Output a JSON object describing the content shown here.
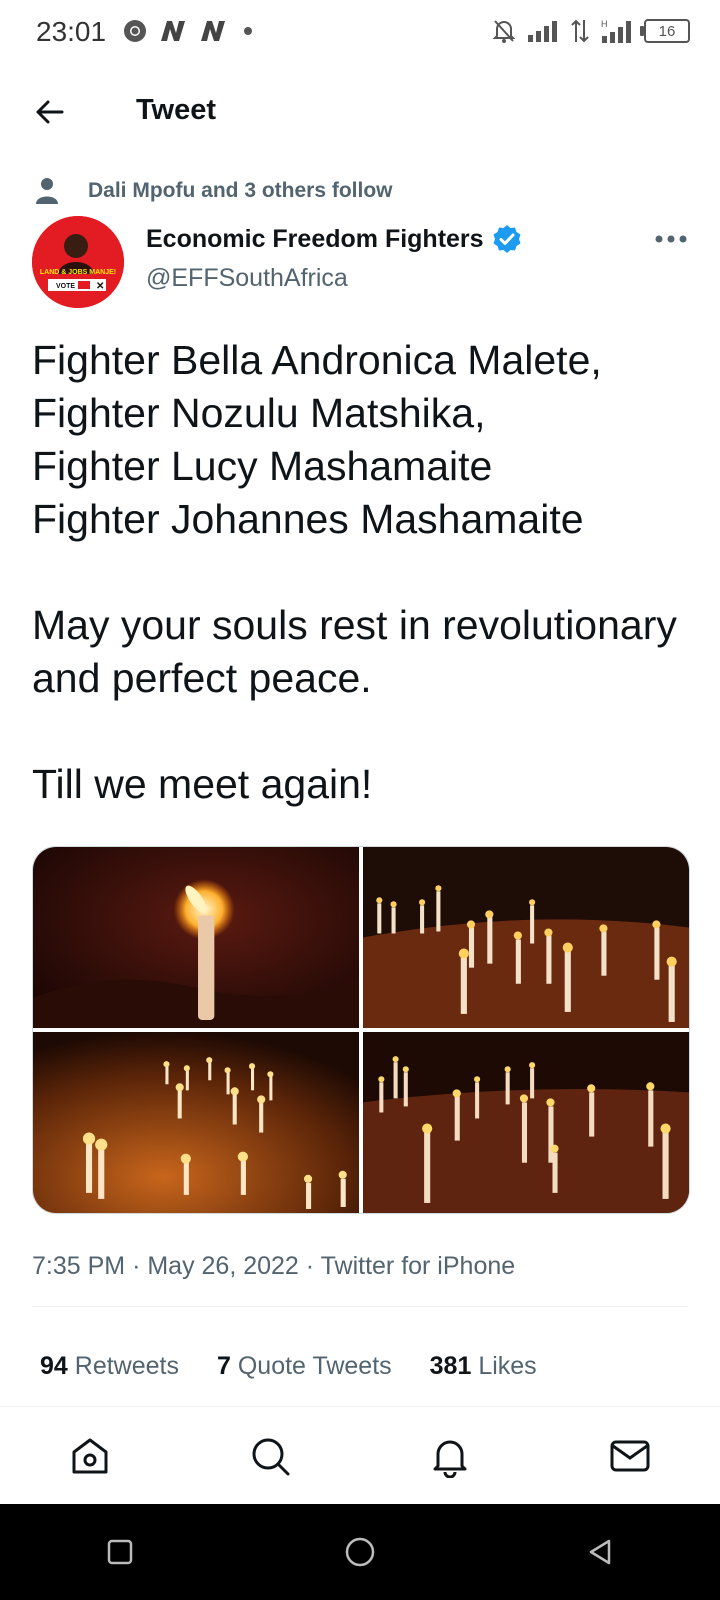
{
  "status_bar": {
    "time": "23:01",
    "battery": "16",
    "left_icons": [
      "chrome-icon",
      "n-notification-icon",
      "n-notification-icon",
      "dot-icon"
    ],
    "right_icons": [
      "notifications-off-icon",
      "signal-icon",
      "data-arrows-icon",
      "signal-h-icon",
      "battery-icon"
    ]
  },
  "header": {
    "title": "Tweet"
  },
  "social_context": {
    "text": "Dali Mpofu and 3 others follow"
  },
  "author": {
    "name": "Economic Freedom Fighters",
    "handle": "@EFFSouthAfrica",
    "verified": true,
    "avatar_caption": "LAND & JOBS MANJE!",
    "avatar_vote": "VOTE"
  },
  "tweet": {
    "text": "Fighter Bella Andronica Malete,\nFighter Nozulu Matshika,\nFighter Lucy Mashamaite\nFighter Johannes Mashamaite\n\nMay your souls rest in revolutionary and perfect peace.\n\nTill we meet again!",
    "timestamp_time": "7:35 PM",
    "timestamp_date": "May 26, 2022",
    "source": "Twitter for iPhone"
  },
  "stats": {
    "retweets_count": "94",
    "retweets_label": "Retweets",
    "quote_count": "7",
    "quote_label": "Quote Tweets",
    "likes_count": "381",
    "likes_label": "Likes"
  },
  "bottom_nav": [
    "home-icon",
    "search-icon",
    "notifications-icon",
    "messages-icon"
  ],
  "android_nav": [
    "recents-icon",
    "home-circle-icon",
    "back-triangle-icon"
  ],
  "colors": {
    "text_primary": "#0f1419",
    "text_secondary": "#536471",
    "verified_blue": "#1d9bf0",
    "eff_red": "#e31b23"
  }
}
